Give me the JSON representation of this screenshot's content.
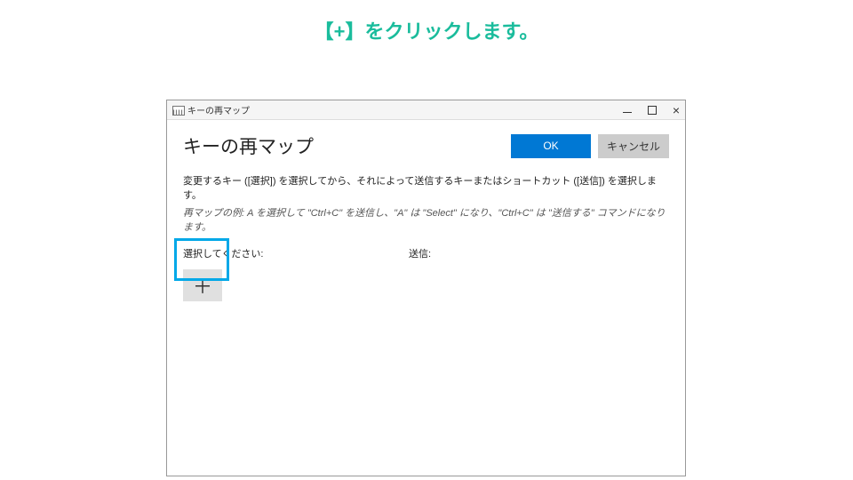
{
  "annotation": "【+】をクリックします。",
  "window": {
    "title": "キーの再マップ",
    "controls": {
      "minimize": "–",
      "maximize": "□",
      "close": "×"
    }
  },
  "header": {
    "title": "キーの再マップ",
    "ok": "OK",
    "cancel": "キャンセル"
  },
  "description": "変更するキー ([選択]) を選択してから、それによって送信するキーまたはショートカット ([送信]) を選択します。",
  "example": "再マップの例: A を選択して \"Ctrl+C\" を送信し、\"A\" は \"Select\" になり、\"Ctrl+C\" は \"送信する\" コマンドになります。",
  "columns": {
    "select_label": "選択してください:",
    "send_label": "送信:"
  },
  "add_button": "＋"
}
